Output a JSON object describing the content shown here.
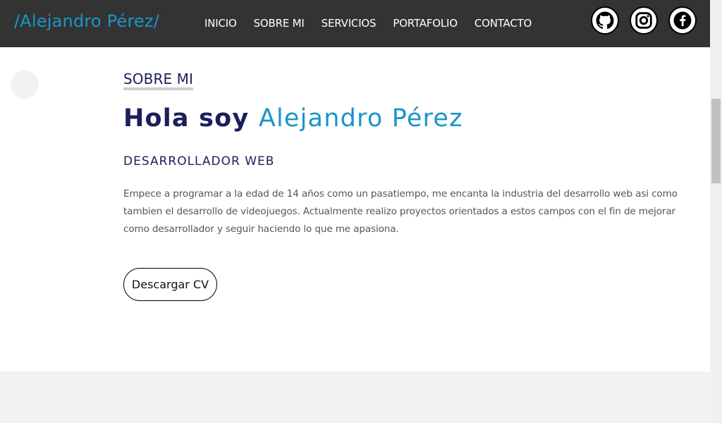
{
  "header": {
    "logo": "/Alejandro Pérez/",
    "nav": [
      {
        "label": "INICIO"
      },
      {
        "label": "SOBRE MI"
      },
      {
        "label": "SERVICIOS"
      },
      {
        "label": "PORTAFOLIO"
      },
      {
        "label": "CONTACTO"
      }
    ],
    "social": [
      {
        "icon": "github-icon"
      },
      {
        "icon": "instagram-icon"
      },
      {
        "icon": "facebook-icon"
      }
    ]
  },
  "about": {
    "section_label": "SOBRE MI",
    "greeting": "Hola soy ",
    "name": "Alejandro Pérez",
    "role": "DESARROLLADOR WEB",
    "bio": "Empece a programar a la edad de 14 años como un pasatiempo, me encanta la industria del desarrollo web asi como tambien el desarrollo de videojuegos. Actualmente realizo proyectos orientados a estos campos con el fin de mejorar como desarrollador y seguir haciendo lo que me apasiona.",
    "cv_button": "Descargar CV"
  },
  "colors": {
    "header_bg": "#333333",
    "accent": "#1a95c9",
    "heading": "#1b1f5c",
    "body_text": "#555555",
    "section_alt_bg": "#f2f2f2"
  }
}
